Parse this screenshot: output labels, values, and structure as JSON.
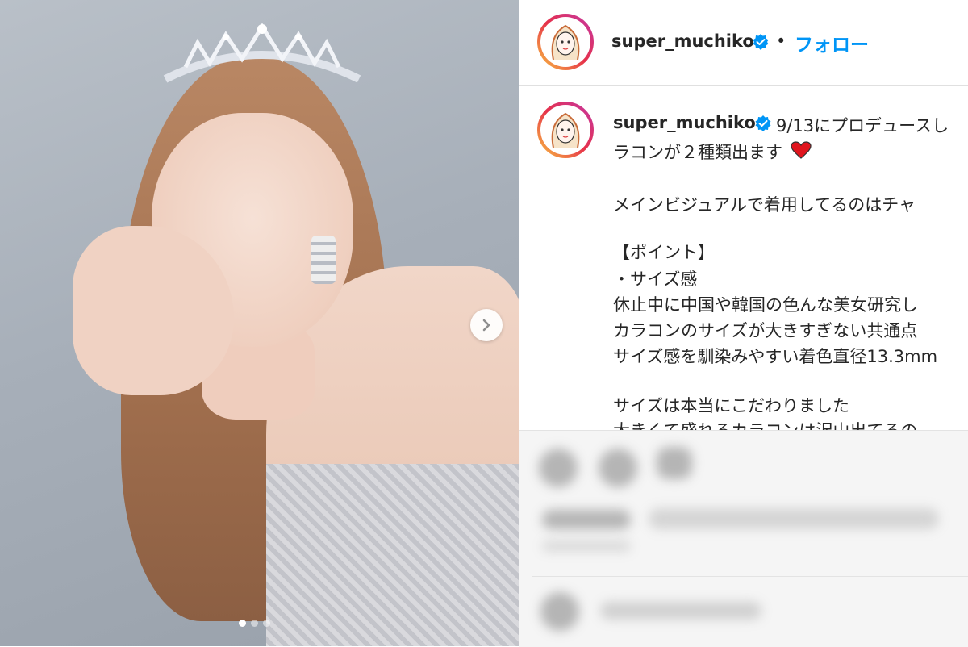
{
  "post": {
    "image_alt": "Photo of a woman wearing a tiara and earrings",
    "carousel": {
      "current": 1,
      "total": 3
    }
  },
  "header": {
    "username": "super_muchiko",
    "bullet": "•",
    "follow_label": "フォロー"
  },
  "caption": {
    "username": "super_muchiko",
    "lines": [
      "9/13にプロデュースし",
      "ラコンが２種類出ます",
      "",
      "メインビジュアルで着用してるのはチャ",
      "",
      "【ポイント】",
      "・サイズ感",
      "休止中に中国や韓国の色んな美女研究し",
      "カラコンのサイズが大きすぎない共通点",
      "サイズ感を馴染みやすい着色直径13.3mm",
      "",
      "サイズは本当にこだわりました",
      "大きくて盛れるカラコンは沢山出てるの"
    ]
  },
  "colors": {
    "follow": "#0095f6",
    "verified": "#0095f6",
    "heart": "#e0151e"
  }
}
